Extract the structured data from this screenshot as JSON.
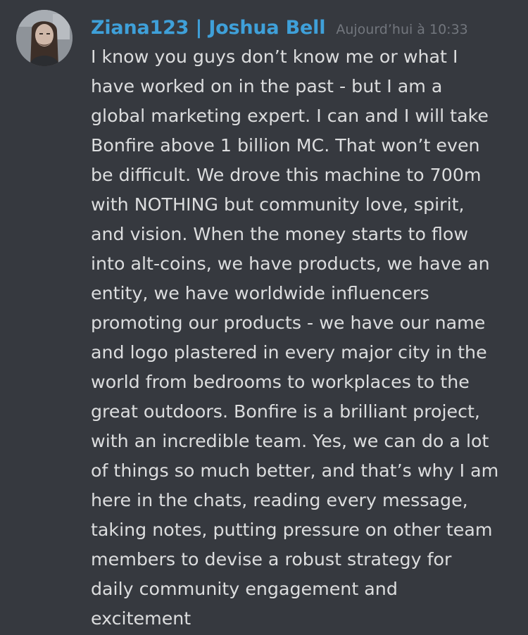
{
  "message": {
    "author": "Ziana123 | Joshua Bell",
    "timestamp": "Aujourd’hui à 10:33",
    "content": "I know you guys don’t know me or what I\nhave worked on in the past - but I am a\nglobal marketing expert. I can and I will take\nBonfire above 1 billion MC. That won’t even\nbe difficult. We drove this machine to 700m\nwith NOTHING but community love, spirit,\nand vision. When the money starts to flow\ninto alt-coins, we have products, we have an\nentity, we have worldwide influencers\npromoting our products - we have our name\nand logo plastered in every major city in the\nworld from bedrooms to workplaces to the\ngreat outdoors. Bonfire is a brilliant project,\nwith an incredible team. Yes, we can do a lot\nof things so much better, and that’s why I am\nhere in the chats, reading every message,\ntaking notes, putting pressure on other team\nmembers to devise a robust strategy for\ndaily community engagement and\nexcitement"
  },
  "colors": {
    "background": "#36393f",
    "author": "#3fa0d9",
    "timestamp": "#72767d",
    "text": "#dcddde"
  },
  "icons": {
    "avatar": "user-avatar"
  }
}
